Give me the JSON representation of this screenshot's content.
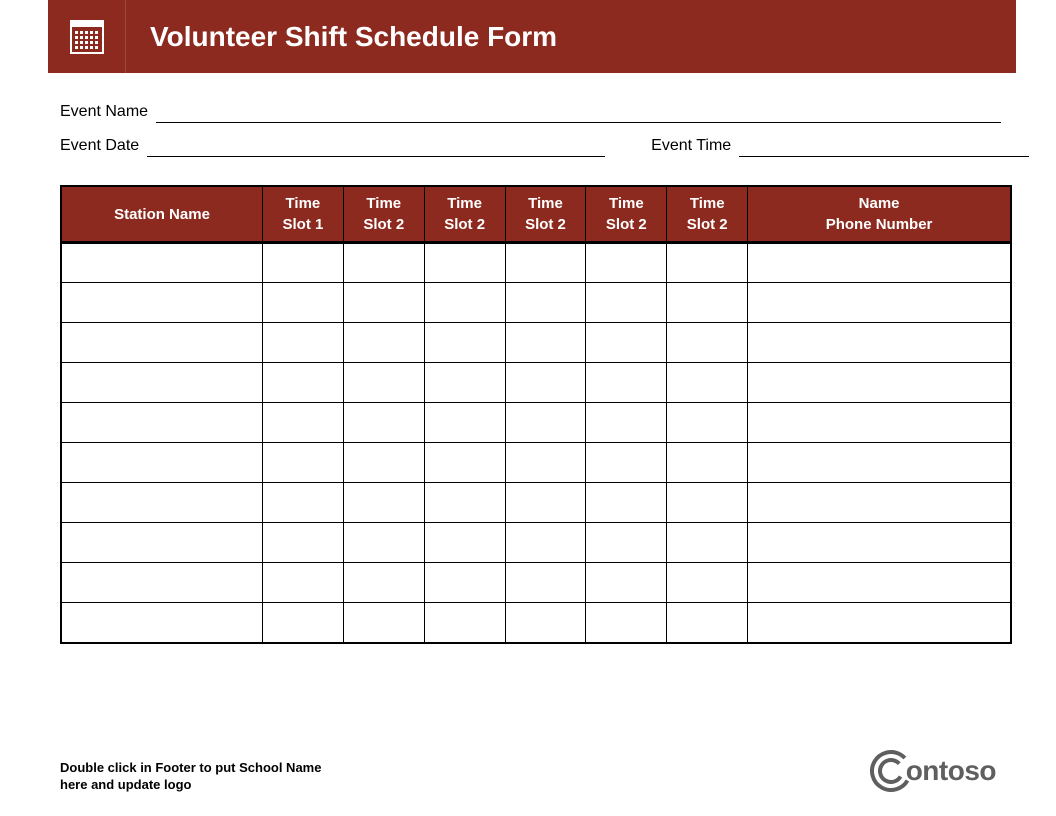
{
  "header": {
    "title": "Volunteer Shift Schedule Form"
  },
  "fields": {
    "event_name_label": "Event Name",
    "event_name_value": "",
    "event_date_label": "Event Date",
    "event_date_value": "",
    "event_time_label": "Event Time",
    "event_time_value": ""
  },
  "table": {
    "headers": {
      "station": "Station Name",
      "slot1_line1": "Time",
      "slot1_line2": "Slot 1",
      "slot2_line1": "Time",
      "slot2_line2": "Slot 2",
      "slot3_line1": "Time",
      "slot3_line2": "Slot 2",
      "slot4_line1": "Time",
      "slot4_line2": "Slot 2",
      "slot5_line1": "Time",
      "slot5_line2": "Slot 2",
      "slot6_line1": "Time",
      "slot6_line2": "Slot 2",
      "name_line1": "Name",
      "name_line2": "Phone Number"
    },
    "row_count": 10
  },
  "footer": {
    "note_line1": "Double click in Footer to put School Name",
    "note_line2": "here and update logo",
    "logo_text": "ontoso"
  },
  "colors": {
    "brand": "#8d2a1f",
    "logo": "#5f5f5f"
  }
}
